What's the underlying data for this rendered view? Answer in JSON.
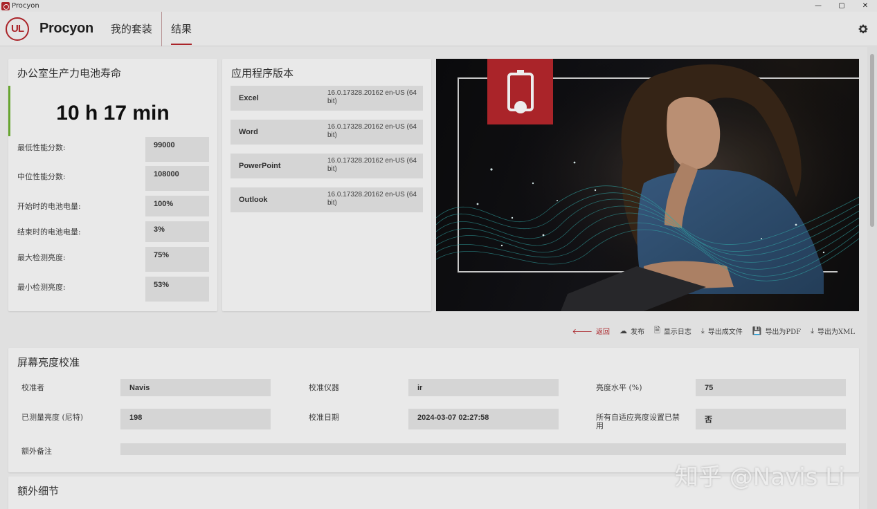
{
  "window": {
    "title": "Procyon",
    "controls": [
      "—",
      "▢",
      "✕"
    ]
  },
  "header": {
    "logo_text": "UL",
    "brand": "Procyon",
    "tabs": [
      {
        "label": "我的套装",
        "active": false
      },
      {
        "label": "结果",
        "active": true
      }
    ],
    "settings_icon": "gear-icon"
  },
  "score_card": {
    "title": "办公室生产力电池寿命",
    "score": "10 h 17 min",
    "status_color": "#6fb234",
    "metrics": [
      {
        "label": "最低性能分数:",
        "value": "99000"
      },
      {
        "label": "中位性能分数:",
        "value": "108000"
      },
      {
        "label": "开始时的电池电量:",
        "value": "100%"
      },
      {
        "label": "结束时的电池电量:",
        "value": "3%"
      },
      {
        "label": "最大检测亮度:",
        "value": "75%"
      },
      {
        "label": "最小检测亮度:",
        "value": "53%"
      }
    ]
  },
  "apps_card": {
    "title": "应用程序版本",
    "apps": [
      {
        "name": "Excel",
        "version": "16.0.17328.20162 en-US (64 bit)"
      },
      {
        "name": "Word",
        "version": "16.0.17328.20162 en-US (64 bit)"
      },
      {
        "name": "PowerPoint",
        "version": "16.0.17328.20162 en-US (64 bit)"
      },
      {
        "name": "Outlook",
        "version": "16.0.17328.20162 en-US (64 bit)"
      }
    ]
  },
  "hero": {
    "badge_icon": "battery-icon",
    "badge_color": "#b7272d"
  },
  "actions": [
    {
      "label": "返回",
      "icon": "back-arrow-icon"
    },
    {
      "label": "发布",
      "icon": "cloud-upload-icon"
    },
    {
      "label": "显示日志",
      "icon": "document-icon"
    },
    {
      "label": "导出成文件",
      "icon": "download-icon"
    },
    {
      "label": "导出为PDF",
      "icon": "save-icon"
    },
    {
      "label": "导出为XML",
      "icon": "download-icon"
    }
  ],
  "calibration": {
    "title": "屏幕亮度校准",
    "fields": [
      {
        "label": "校准者",
        "value": "Navis"
      },
      {
        "label": "校准仪器",
        "value": "ir"
      },
      {
        "label": "亮度水平 (%)",
        "value": "75"
      },
      {
        "label": "已测量亮度 (尼特)",
        "value": "198"
      },
      {
        "label": "校准日期",
        "value": "2024-03-07 02:27:58"
      },
      {
        "label": "所有自适应亮度设置已禁用",
        "value": "否"
      },
      {
        "label": "额外备注",
        "value": ""
      }
    ]
  },
  "extra": {
    "title": "额外细节"
  },
  "watermark": "知乎 @Navis Li"
}
